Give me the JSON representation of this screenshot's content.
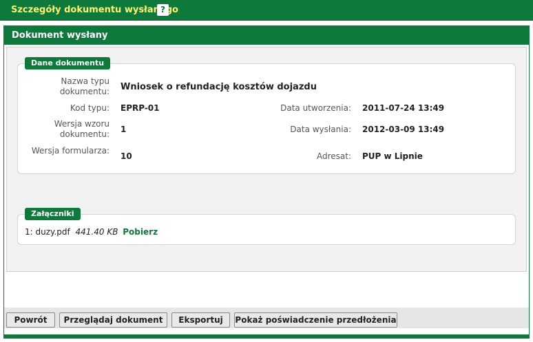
{
  "window": {
    "title": "Szczegóły dokumentu wysłanego",
    "help_label": "?"
  },
  "panel": {
    "title": "Dokument wysłany"
  },
  "document_details": {
    "legend": "Dane dokumentu",
    "fields": {
      "document_type_name": {
        "label": "Nazwa typu dokumentu:",
        "value": "Wniosek o refundację kosztów dojazdu"
      },
      "type_code": {
        "label": "Kod typu:",
        "value": "EPRP-01"
      },
      "template_version": {
        "label": "Wersja wzoru dokumentu:",
        "value": "1"
      },
      "form_version": {
        "label": "Wersja formularza:",
        "value": "10"
      },
      "created_date": {
        "label": "Data utworzenia:",
        "value": "2011-07-24 13:49"
      },
      "sent_date": {
        "label": "Data wysłania:",
        "value": "2012-03-09 13:49"
      },
      "recipient": {
        "label": "Adresat:",
        "value": "PUP w Lipnie"
      }
    }
  },
  "attachments": {
    "legend": "Załączniki",
    "items": [
      {
        "index": "1:",
        "name": "duzy.pdf",
        "size": "441.40 KB",
        "download_label": "Pobierz"
      }
    ]
  },
  "buttons": {
    "back": "Powrót",
    "view_document": "Przeglądaj dokument",
    "export": "Eksportuj",
    "show_certificate": "Pokaż poświadczenie przedłożenia"
  },
  "colors": {
    "brand_green": "#0d7a3c",
    "title_yellow": "#fff36b"
  }
}
